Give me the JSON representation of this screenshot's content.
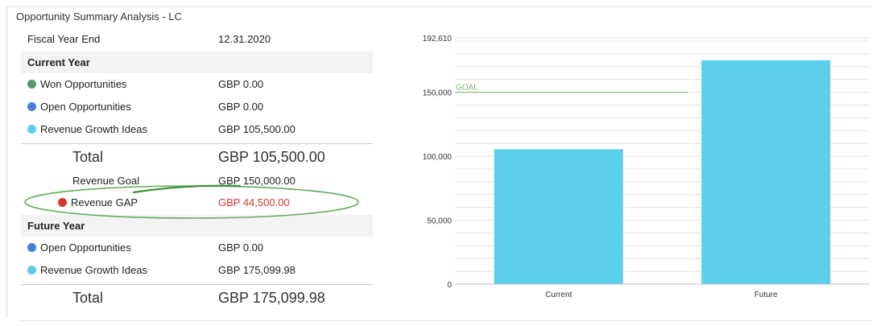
{
  "title": "Opportunity Summary Analysis - LC",
  "fiscal_year": {
    "label": "Fiscal Year End",
    "value": "12.31.2020"
  },
  "current_year": {
    "heading": "Current Year",
    "items": [
      {
        "label": "Won Opportunities",
        "value": "GBP 0.00",
        "color": "#4e9a6e"
      },
      {
        "label": "Open Opportunities",
        "value": "GBP 0.00",
        "color": "#4a7fd6"
      },
      {
        "label": "Revenue Growth Ideas",
        "value": "GBP 105,500.00",
        "color": "#5ccbe8"
      }
    ],
    "total": {
      "label": "Total",
      "value": "GBP 105,500.00"
    },
    "goal": {
      "label": "Revenue Goal",
      "value": "GBP 150,000.00"
    },
    "gap": {
      "label": "Revenue GAP",
      "value": "GBP 44,500.00",
      "color": "#d9362e"
    }
  },
  "future_year": {
    "heading": "Future Year",
    "items": [
      {
        "label": "Open Opportunities",
        "value": "GBP 0.00",
        "color": "#4a7fd6"
      },
      {
        "label": "Revenue Growth Ideas",
        "value": "GBP 175,099.98",
        "color": "#5ccbe8"
      }
    ],
    "total": {
      "label": "Total",
      "value": "GBP 175,099.98"
    }
  },
  "chart_data": {
    "type": "bar",
    "categories": [
      "Current",
      "Future"
    ],
    "values": [
      105500,
      175099.98
    ],
    "ylim": [
      0,
      192610
    ],
    "yticks": [
      {
        "value": 0,
        "label": "0"
      },
      {
        "value": 50000,
        "label": "50,000"
      },
      {
        "value": 100000,
        "label": "100,000"
      },
      {
        "value": 150000,
        "label": "150,000"
      },
      {
        "value": 192610,
        "label": "192,610"
      }
    ],
    "goal_line": {
      "value": 150000,
      "label": "GOAL",
      "color": "#7bb87a"
    },
    "bar_color": "#5ccfea",
    "grid": true
  }
}
